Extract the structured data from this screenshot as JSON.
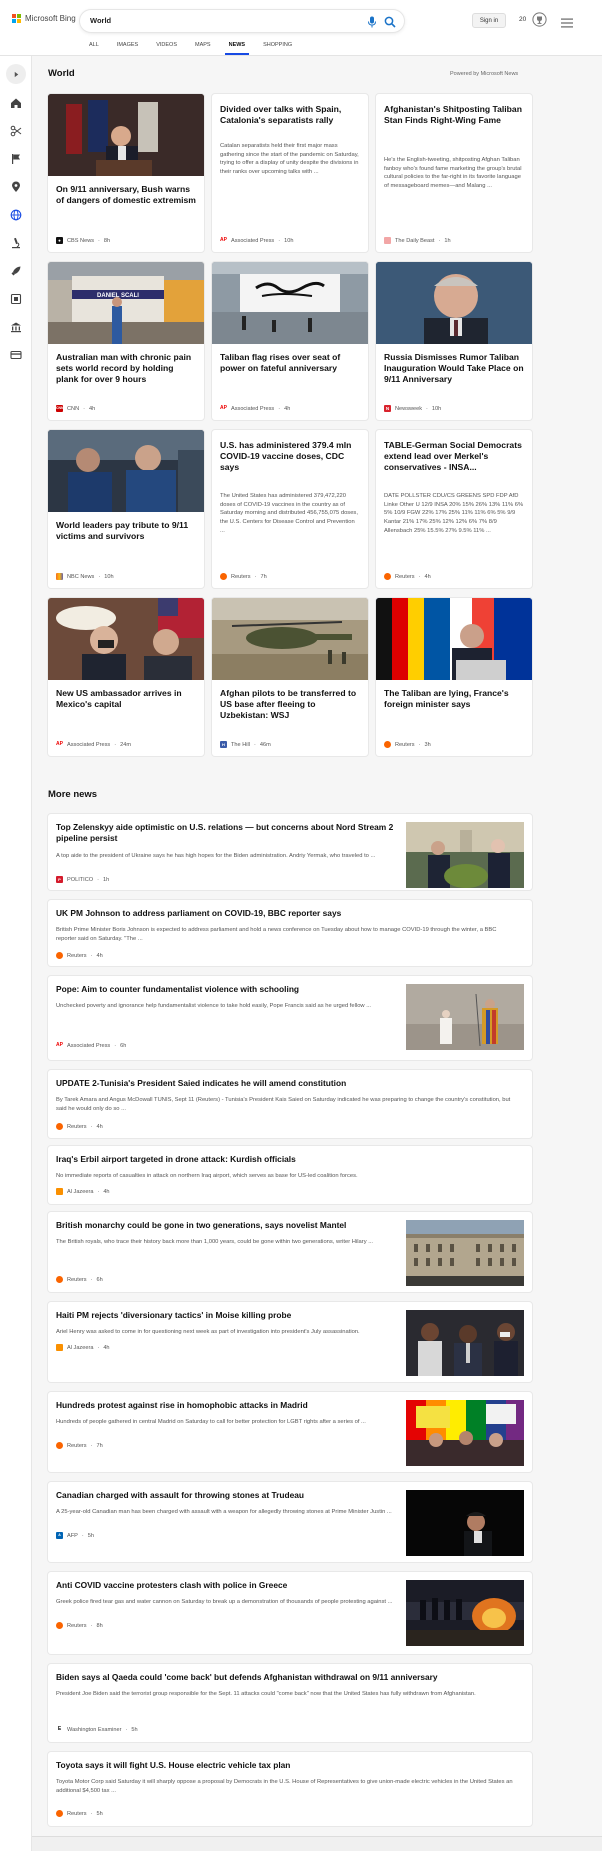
{
  "header": {
    "brand": "Microsoft Bing",
    "search_value": "World",
    "sign_in": "Sign in",
    "rewards_count": "20",
    "tabs": [
      "ALL",
      "IMAGES",
      "VIDEOS",
      "MAPS",
      "NEWS",
      "SHOPPING"
    ],
    "active_tab": "NEWS"
  },
  "section": {
    "title": "World",
    "powered_by": "Powered by Microsoft News"
  },
  "top_cards": [
    {
      "title": "On 9/11 anniversary, Bush warns of dangers of domestic extremism",
      "source": "CBS News",
      "time": "8h",
      "has_image": true
    },
    {
      "title": "Divided over talks with Spain, Catalonia's separatists rally",
      "snippet": "Catalan separatists held their first major mass gathering since the start of the pandemic on Saturday, trying to offer a display of unity despite the divisions in their ranks over upcoming talks with ...",
      "source": "Associated Press",
      "time": "10h",
      "has_image": false
    },
    {
      "title": "Afghanistan's Shitposting Taliban Stan Finds Right-Wing Fame",
      "snippet": "He's the English-tweeting, shitposting Afghan Taliban fanboy who's found fame marketing the group's brutal cultural policies to the far-right in its favorite language of messageboard memes—and Malang ...",
      "source": "The Daily Beast",
      "time": "1h",
      "has_image": false
    },
    {
      "title": "Australian man with chronic pain sets world record by holding plank for over 9 hours",
      "source": "CNN",
      "time": "4h",
      "has_image": true,
      "image_text": "DANIEL SCALI"
    },
    {
      "title": "Taliban flag rises over seat of power on fateful anniversary",
      "source": "Associated Press",
      "time": "4h",
      "has_image": true
    },
    {
      "title": "Russia Dismisses Rumor Taliban Inauguration Would Take Place on 9/11 Anniversary",
      "source": "Newsweek",
      "time": "10h",
      "has_image": true
    },
    {
      "title": "World leaders pay tribute to 9/11 victims and survivors",
      "source": "NBC News",
      "time": "10h",
      "has_image": true
    },
    {
      "title": "U.S. has administered 379.4 mln COVID-19 vaccine doses, CDC says",
      "snippet": "The United States has administered 379,472,220 doses of COVID-19 vaccines in the country as of Saturday morning and distributed 456,755,075 doses, the U.S. Centers for Disease Control and Prevention ...",
      "source": "Reuters",
      "time": "7h",
      "has_image": false
    },
    {
      "title": "TABLE-German Social Democrats extend lead over Merkel's conservatives - INSA...",
      "snippet": "DATE POLLSTER CDU/CS GREENS SPD FDP AfD Linke Other U 12/9 INSA 20% 15% 26% 13% 11% 6% 5% 10/9 FGW 22% 17% 25% 11% 11% 6% 5% 9/9 Kantar 21% 17% 25% 12% 12% 6% 7% 8/9 Allensbach 25% 15.5% 27% 9.5% 11% ...",
      "source": "Reuters",
      "time": "4h",
      "has_image": false
    },
    {
      "title": "New US ambassador arrives in Mexico's capital",
      "source": "Associated Press",
      "time": "24m",
      "has_image": true
    },
    {
      "title": "Afghan pilots to be transferred to US base after fleeing to Uzbekistan: WSJ",
      "source": "The Hill",
      "time": "46m",
      "has_image": true
    },
    {
      "title": "The Taliban are lying, France's foreign minister says",
      "source": "Reuters",
      "time": "3h",
      "has_image": true
    }
  ],
  "more_news": {
    "title": "More news",
    "items": [
      {
        "title": "Top Zelenskyy aide optimistic on U.S. relations — but concerns about Nord Stream 2 pipeline persist",
        "snippet": "A top aide to the president of Ukraine says he has high hopes for the Biden administration. Andriy Yermak, who traveled to ...",
        "source": "POLITICO",
        "time": "1h",
        "has_image": true
      },
      {
        "title": "UK PM Johnson to address parliament on COVID-19, BBC reporter says",
        "snippet": "British Prime Minister Boris Johnson is expected to address parliament and hold a news conference on Tuesday about how to manage COVID-19 through the winter, a BBC reporter said on Saturday. \"The ...",
        "source": "Reuters",
        "time": "4h",
        "has_image": false
      },
      {
        "title": "Pope: Aim to counter fundamentalist violence with schooling",
        "snippet": "Unchecked poverty and ignorance help fundamentalist violence to take hold easily, Pope Francis said as he urged fellow ...",
        "source": "Associated Press",
        "time": "6h",
        "has_image": true
      },
      {
        "title": "UPDATE 2-Tunisia's President Saied indicates he will amend constitution",
        "snippet": "By Tarek Amara and Angus McDowall TUNIS, Sept 11 (Reuters) - Tunisia's President Kais Saied on Saturday indicated he was preparing to change the country's constitution, but said he would only do so ...",
        "source": "Reuters",
        "time": "4h",
        "has_image": false
      },
      {
        "title": "Iraq's Erbil airport targeted in drone attack: Kurdish officials",
        "snippet": "No immediate reports of casualties in attack on northern Iraq airport, which serves as base for US-led coalition forces.",
        "source": "Al Jazeera",
        "time": "4h",
        "has_image": false
      },
      {
        "title": "British monarchy could be gone in two generations, says novelist Mantel",
        "snippet": "The British royals, who trace their history back more than 1,000 years, could be gone within two generations, writer Hilary ...",
        "source": "Reuters",
        "time": "6h",
        "has_image": true
      },
      {
        "title": "Haiti PM rejects 'diversionary tactics' in Moise killing probe",
        "snippet": "Ariel Henry was asked to come in for questioning next week as part of investigation into president's July assassination.",
        "source": "Al Jazeera",
        "time": "4h",
        "has_image": true
      },
      {
        "title": "Hundreds protest against rise in homophobic attacks in Madrid",
        "snippet": "Hundreds of people gathered in central Madrid on Saturday to call for better protection for LGBT rights after a series of ...",
        "source": "Reuters",
        "time": "7h",
        "has_image": true
      },
      {
        "title": "Canadian charged with assault for throwing stones at Trudeau",
        "snippet": "A 25-year-old Canadian man has been charged with assault with a weapon for allegedly throwing stones at Prime Minister Justin ...",
        "source": "AFP",
        "time": "5h",
        "has_image": true
      },
      {
        "title": "Anti COVID vaccine protesters clash with police in Greece",
        "snippet": "Greek police fired tear gas and water cannon on Saturday to break up a demonstration of thousands of people protesting against ...",
        "source": "Reuters",
        "time": "8h",
        "has_image": true
      },
      {
        "title": "Biden says al Qaeda could 'come back' but defends Afghanistan withdrawal on 9/11 anniversary",
        "snippet": "President Joe Biden said the terrorist group responsible for the Sept. 11 attacks could \"come back\" now that the United States has fully withdrawn from Afghanistan.",
        "source": "Washington Examiner",
        "time": "5h",
        "has_image": false
      },
      {
        "title": "Toyota says it will fight U.S. House electric vehicle tax plan",
        "snippet": "Toyota Motor Corp said Saturday it will sharply oppose a proposal by Democrats in the U.S. House of Representatives to give union-made electric vehicles in the United States an additional $4,500 tax ...",
        "source": "Reuters",
        "time": "5h",
        "has_image": false
      }
    ]
  },
  "colors": {
    "accent": "#174ae4",
    "bing_teal": "#0f7ea8",
    "card_bg": "#ffffff",
    "page_bg": "#f6f6f6"
  }
}
